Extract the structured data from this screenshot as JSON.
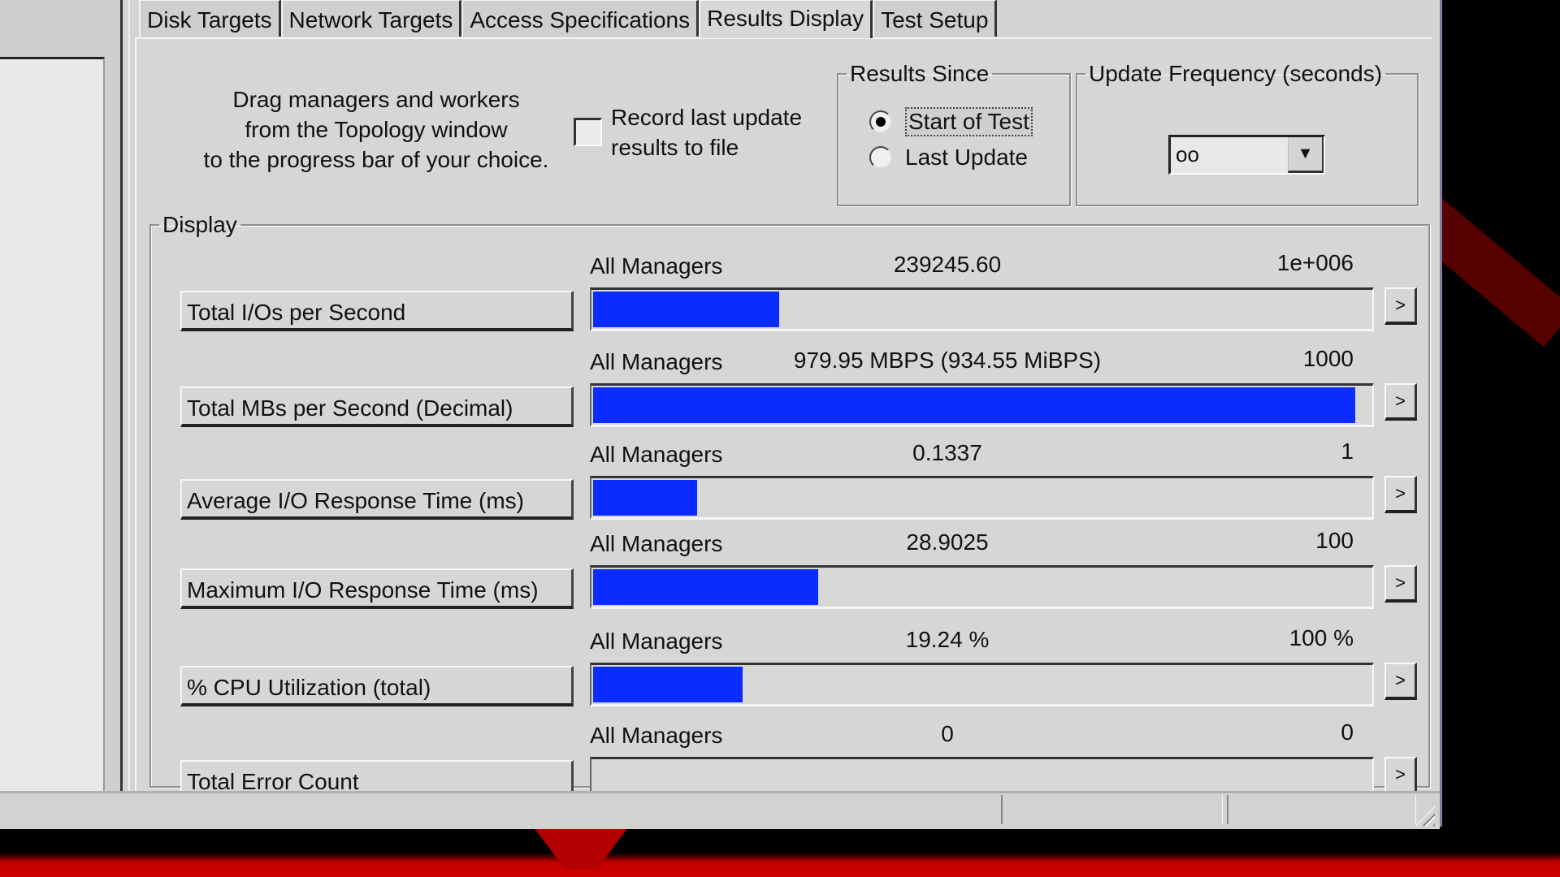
{
  "tabs": [
    {
      "label": "Disk Targets",
      "active": false
    },
    {
      "label": "Network Targets",
      "active": false
    },
    {
      "label": "Access Specifications",
      "active": false
    },
    {
      "label": "Results Display",
      "active": true
    },
    {
      "label": "Test Setup",
      "active": false
    }
  ],
  "instructions": {
    "line1": "Drag managers and workers",
    "line2": "from the Topology window",
    "line3": "to the progress bar of your choice."
  },
  "record": {
    "line1": "Record last update",
    "line2": "results to file",
    "checked": false
  },
  "results_since": {
    "title": "Results Since",
    "options": [
      {
        "label": "Start of Test",
        "checked": true
      },
      {
        "label": "Last Update",
        "checked": false
      }
    ]
  },
  "update_frequency": {
    "title": "Update Frequency (seconds)",
    "value": "oo",
    "dropdown_icon": "triangle-down"
  },
  "display": {
    "title": "Display",
    "bar_color": "#0a2cff",
    "rows": [
      {
        "label": "Total I/Os per Second",
        "manager": "All Managers",
        "value": "239245.60",
        "max": "1e+006",
        "fraction": 0.239,
        "arrow": ">"
      },
      {
        "label": "Total MBs per Second (Decimal)",
        "manager": "All Managers",
        "value": "979.95 MBPS (934.55 MiBPS)",
        "max": "1000",
        "fraction": 0.98,
        "arrow": ">"
      },
      {
        "label": "Average I/O Response Time (ms)",
        "manager": "All Managers",
        "value": "0.1337",
        "max": "1",
        "fraction": 0.1337,
        "arrow": ">"
      },
      {
        "label": "Maximum I/O Response Time (ms)",
        "manager": "All Managers",
        "value": "28.9025",
        "max": "100",
        "fraction": 0.289,
        "arrow": ">"
      },
      {
        "label": "% CPU Utilization (total)",
        "manager": "All Managers",
        "value": "19.24 %",
        "max": "100 %",
        "fraction": 0.1924,
        "arrow": ">"
      },
      {
        "label": "Total Error Count",
        "manager": "All Managers",
        "value": "0",
        "max": "0",
        "fraction": 0,
        "arrow": ">"
      }
    ]
  }
}
